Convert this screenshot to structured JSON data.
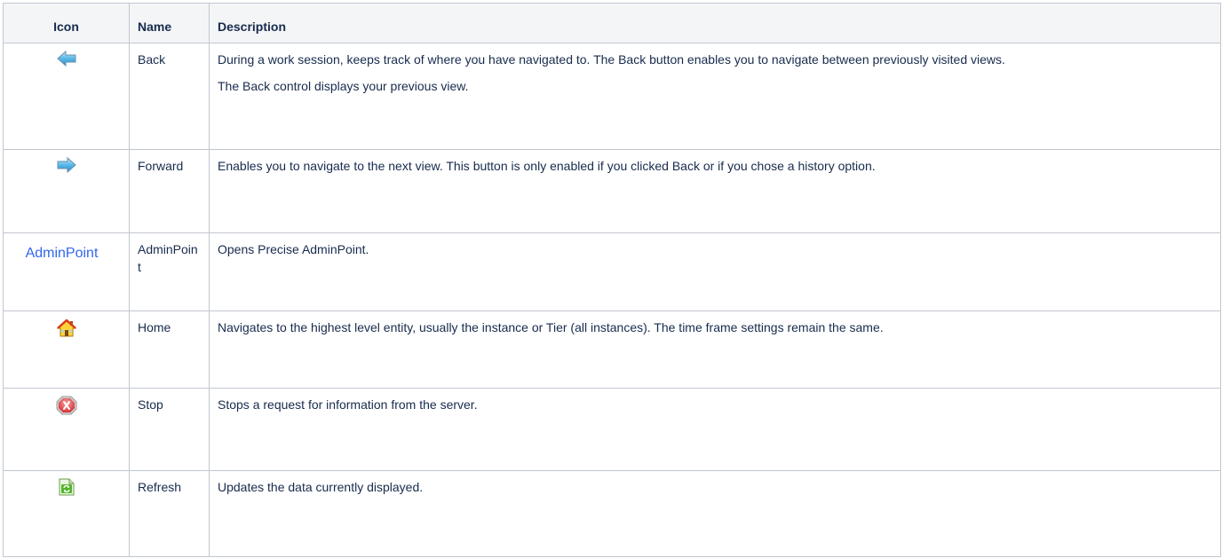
{
  "table": {
    "headers": {
      "icon": "Icon",
      "name": "Name",
      "description": "Description"
    },
    "rows": [
      {
        "icon": "back-arrow-icon",
        "name": "Back",
        "description": [
          "During a work session, keeps track of where you have navigated to. The Back button enables you to navigate between previously visited views.",
          "The Back control displays your previous view."
        ]
      },
      {
        "icon": "forward-arrow-icon",
        "name": "Forward",
        "description": [
          "Enables you to navigate to the next view. This button is only enabled if you clicked Back or if you chose a history option."
        ]
      },
      {
        "icon": "adminpoint-link",
        "icon_text": "AdminPoint",
        "name": "AdminPoint",
        "description": [
          "Opens Precise AdminPoint."
        ]
      },
      {
        "icon": "home-icon",
        "name": "Home",
        "description": [
          "Navigates to the highest level entity, usually the instance or Tier (all instances). The time frame settings remain the same."
        ]
      },
      {
        "icon": "stop-icon",
        "name": "Stop",
        "description": [
          "Stops a request for information from the server."
        ]
      },
      {
        "icon": "refresh-icon",
        "name": "Refresh",
        "description": [
          "Updates the data currently displayed."
        ]
      }
    ]
  },
  "colors": {
    "border": "#c1c7d0",
    "header_bg": "#f4f5f7",
    "text": "#172b4d",
    "admin_link": "#3366ee"
  }
}
